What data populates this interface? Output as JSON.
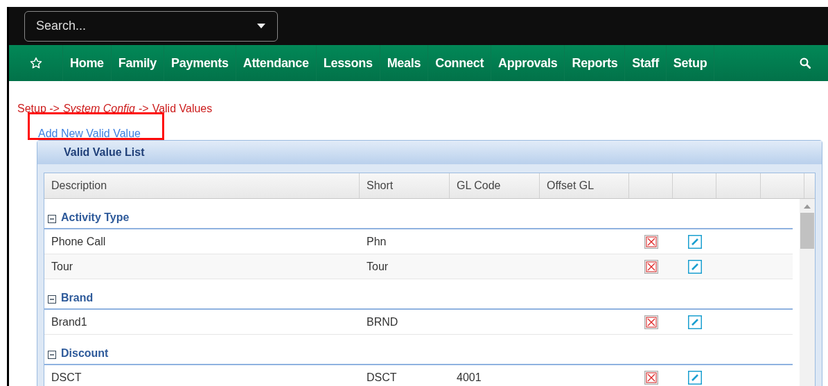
{
  "search": {
    "placeholder": "Search..."
  },
  "nav": [
    "Home",
    "Family",
    "Payments",
    "Attendance",
    "Lessons",
    "Meals",
    "Connect",
    "Approvals",
    "Reports",
    "Staff",
    "Setup"
  ],
  "breadcrumb": {
    "first": "Setup ->",
    "link": "System Config",
    "sep": "->",
    "current": "Valid Values"
  },
  "add_link": "Add New Valid Value",
  "panel_title": "Valid Value List",
  "columns": [
    "Description",
    "Short",
    "GL Code",
    "Offset GL"
  ],
  "groups": [
    {
      "name": "Activity Type",
      "expanded": true,
      "rows": [
        {
          "description": "Phone Call",
          "short": "Phn",
          "gl_code": ""
        },
        {
          "description": "Tour",
          "short": "Tour",
          "gl_code": ""
        }
      ]
    },
    {
      "name": "Brand",
      "expanded": true,
      "rows": [
        {
          "description": "Brand1",
          "short": "BRND",
          "gl_code": ""
        }
      ]
    },
    {
      "name": "Discount",
      "expanded": true,
      "rows": [
        {
          "description": "DSCT",
          "short": "DSCT",
          "gl_code": "4001"
        }
      ]
    }
  ]
}
